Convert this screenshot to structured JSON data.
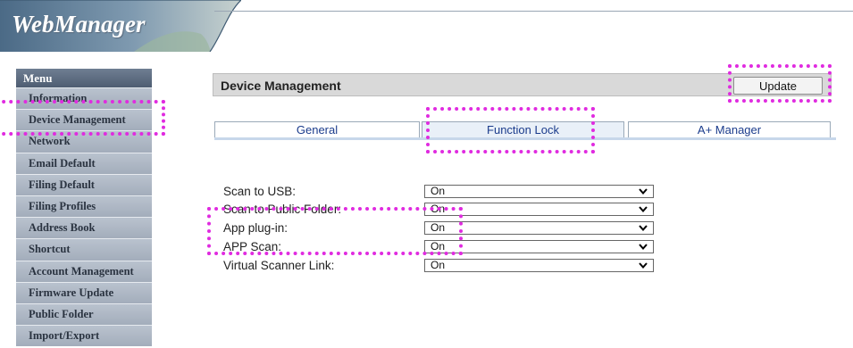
{
  "header": {
    "logo": "WebManager"
  },
  "sidebar": {
    "title": "Menu",
    "items": [
      {
        "label": "Information"
      },
      {
        "label": "Device Management"
      },
      {
        "label": "Network"
      },
      {
        "label": "Email Default"
      },
      {
        "label": "Filing Default"
      },
      {
        "label": "Filing Profiles"
      },
      {
        "label": "Address Book"
      },
      {
        "label": "Shortcut"
      },
      {
        "label": "Account Management"
      },
      {
        "label": "Firmware Update"
      },
      {
        "label": "Public Folder"
      },
      {
        "label": "Import/Export"
      }
    ]
  },
  "main": {
    "title": "Device Management",
    "update_label": "Update",
    "tabs": [
      {
        "label": "General"
      },
      {
        "label": "Function Lock"
      },
      {
        "label": "A+ Manager"
      }
    ],
    "active_tab": "Function Lock",
    "settings": [
      {
        "label": "Scan to USB:",
        "value": "On"
      },
      {
        "label": "Scan to Public Folder:",
        "value": "On"
      },
      {
        "label": "App plug-in:",
        "value": "On"
      },
      {
        "label": "APP Scan:",
        "value": "On"
      },
      {
        "label": "Virtual Scanner Link:",
        "value": "On"
      }
    ]
  },
  "colors": {
    "highlight": "#e02be0",
    "tab_text": "#1b3c8c"
  }
}
